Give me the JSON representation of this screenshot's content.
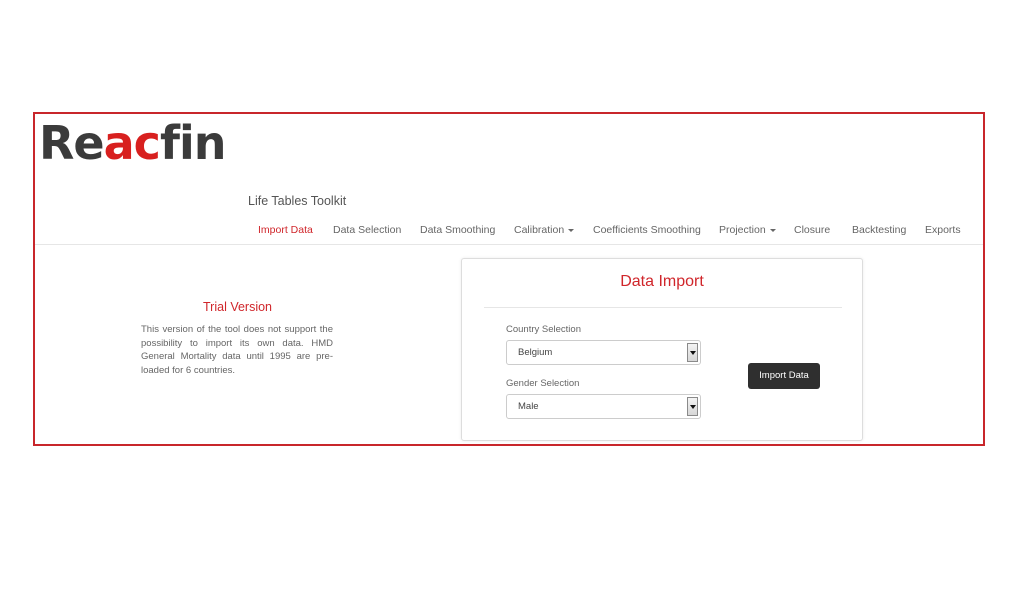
{
  "brand": {
    "logo_part1": "Re",
    "logo_part2": "ac",
    "logo_part3": "fin",
    "accent_color": "#d8201f"
  },
  "app_title": "Life Tables Toolkit",
  "nav": {
    "items": [
      {
        "label": "Import Data",
        "active": true
      },
      {
        "label": "Data Selection"
      },
      {
        "label": "Data Smoothing"
      },
      {
        "label": "Calibration",
        "dropdown": true
      },
      {
        "label": "Coefficients Smoothing"
      },
      {
        "label": "Projection",
        "dropdown": true
      },
      {
        "label": "Closure"
      },
      {
        "label": "Backtesting"
      },
      {
        "label": "Exports"
      }
    ]
  },
  "trial": {
    "title": "Trial Version",
    "text": "This version of the tool does not support the possibility to import its own data. HMD General Mortality data until 1995 are pre-loaded for 6 countries."
  },
  "panel": {
    "title": "Data Import",
    "country_label": "Country Selection",
    "country_value": "Belgium",
    "gender_label": "Gender Selection",
    "gender_value": "Male",
    "button_label": "Import Data"
  }
}
